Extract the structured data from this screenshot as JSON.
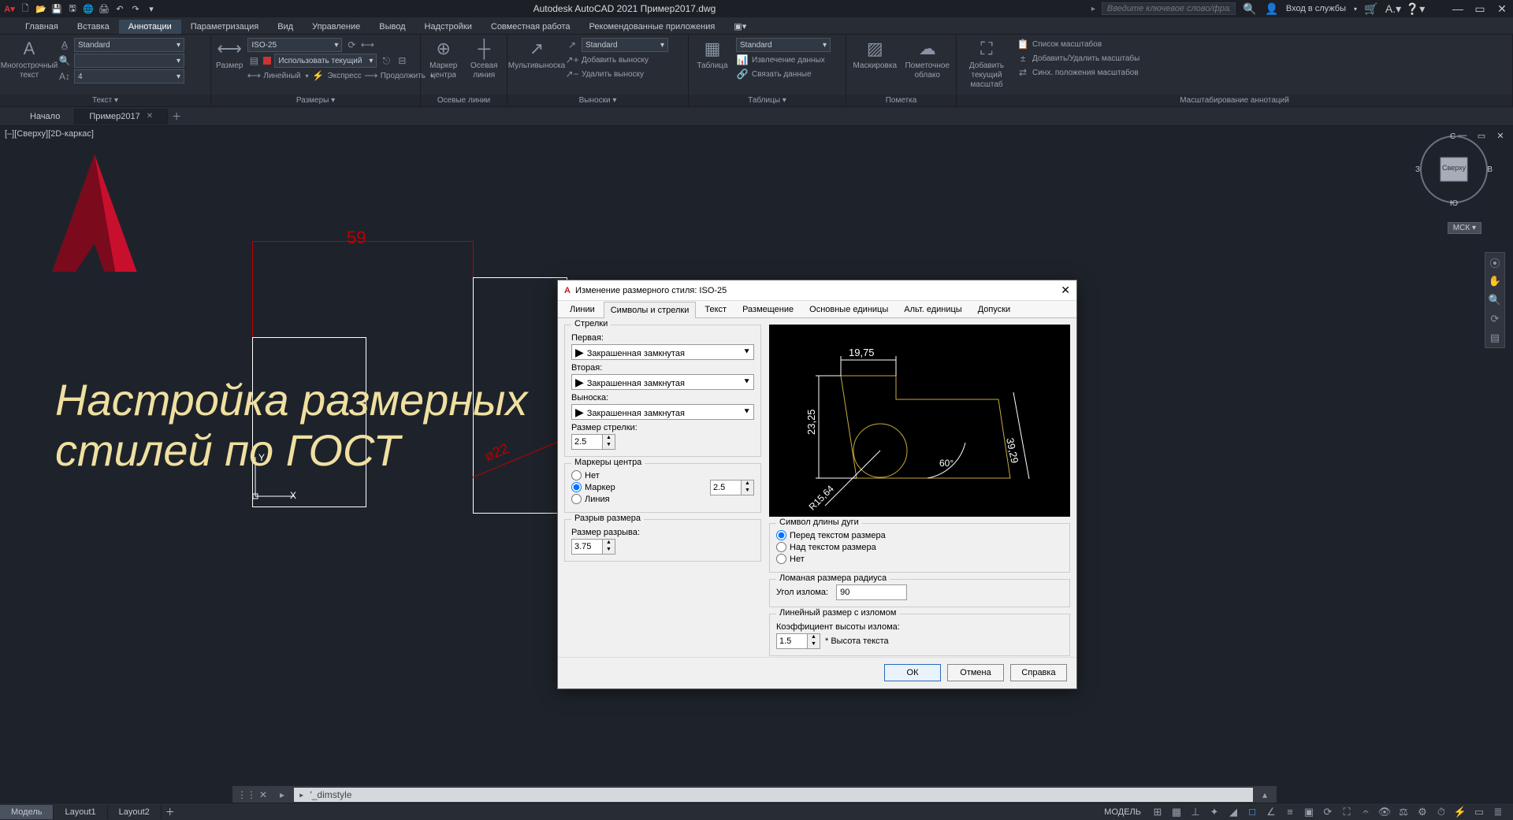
{
  "app_title": "Autodesk AutoCAD 2021    Пример2017.dwg",
  "search_placeholder": "Введите ключевое слово/фразу",
  "login_label": "Вход в службы",
  "menu_tabs": [
    "Главная",
    "Вставка",
    "Аннотации",
    "Параметризация",
    "Вид",
    "Управление",
    "Вывод",
    "Надстройки",
    "Совместная работа",
    "Рекомендованные приложения"
  ],
  "active_menu_tab": 2,
  "ribbon": {
    "text": {
      "panel": "Текст",
      "big": "Многострочный текст",
      "style": "Standard",
      "height": "4"
    },
    "dim": {
      "panel": "Размеры",
      "big": "Размер",
      "style": "ISO-25",
      "use_current": "Использовать текущий",
      "linear": "Линейный",
      "express": "Экспресс",
      "continue": "Продолжить"
    },
    "center": {
      "panel": "Осевые линии",
      "marker": "Маркер центра",
      "axis": "Осевая линия"
    },
    "leader": {
      "panel": "Выноски",
      "big": "Мультивыноска",
      "style": "Standard",
      "add": "Добавить выноску",
      "del": "Удалить выноску"
    },
    "table": {
      "panel": "Таблицы",
      "big": "Таблица",
      "style": "Standard",
      "extract": "Извлечение данных",
      "link": "Связать данные"
    },
    "mark": {
      "panel": "Пометка",
      "mask": "Маскировка",
      "cloud": "Пометочное облако"
    },
    "scale": {
      "panel": "Масштабирование аннотаций",
      "add": "Добавить текущий масштаб",
      "list": "Список масштабов",
      "addrm": "Добавить/Удалить масштабы",
      "sync": "Синх. положения масштабов"
    }
  },
  "doc_tabs": {
    "items": [
      "Начало",
      "Пример2017"
    ],
    "active": 1
  },
  "vp_controls": "[–][Сверху][2D-каркас]",
  "overlay_line1": "Настройка размерных",
  "overlay_line2": "стилей по ГОСТ",
  "dim59": "59",
  "dim_diam": "⌀22",
  "ucs_y": "Y",
  "ucs_x": "X",
  "msk": "МСК",
  "compass": {
    "n": "С",
    "e": "В",
    "s": "Ю",
    "w": "З",
    "top": "Сверху"
  },
  "dialog": {
    "title": "Изменение размерного стиля: ISO-25",
    "tabs": [
      "Линии",
      "Символы и стрелки",
      "Текст",
      "Размещение",
      "Основные единицы",
      "Альт. единицы",
      "Допуски"
    ],
    "active_tab": 1,
    "arrows": {
      "group": "Стрелки",
      "first_lbl": "Первая:",
      "first_val": "Закрашенная замкнутая",
      "second_lbl": "Вторая:",
      "second_val": "Закрашенная замкнутая",
      "leader_lbl": "Выноска:",
      "leader_val": "Закрашенная замкнутая",
      "size_lbl": "Размер стрелки:",
      "size_val": "2.5"
    },
    "center": {
      "group": "Маркеры центра",
      "none": "Нет",
      "mark": "Маркер",
      "line": "Линия",
      "size": "2.5"
    },
    "break": {
      "group": "Разрыв размера",
      "lbl": "Размер разрыва:",
      "val": "3.75"
    },
    "arc": {
      "group": "Символ длины дуги",
      "before": "Перед текстом размера",
      "above": "Над текстом размера",
      "none": "Нет"
    },
    "jog": {
      "group": "Ломаная размера радиуса",
      "lbl": "Угол излома:",
      "val": "90"
    },
    "lin": {
      "group": "Линейный размер с изломом",
      "lbl": "Коэффициент высоты излома:",
      "val": "1.5",
      "hint": "* Высота текста"
    },
    "preview": {
      "d1": "19,75",
      "d2": "23,25",
      "d3": "39,29",
      "ang": "60°",
      "rad": "R15,64"
    },
    "btns": {
      "ok": "ОК",
      "cancel": "Отмена",
      "help": "Справка"
    }
  },
  "cmd_text": "'_dimstyle",
  "layout_tabs": [
    "Модель",
    "Layout1",
    "Layout2"
  ],
  "status_model": "МОДЕЛЬ"
}
